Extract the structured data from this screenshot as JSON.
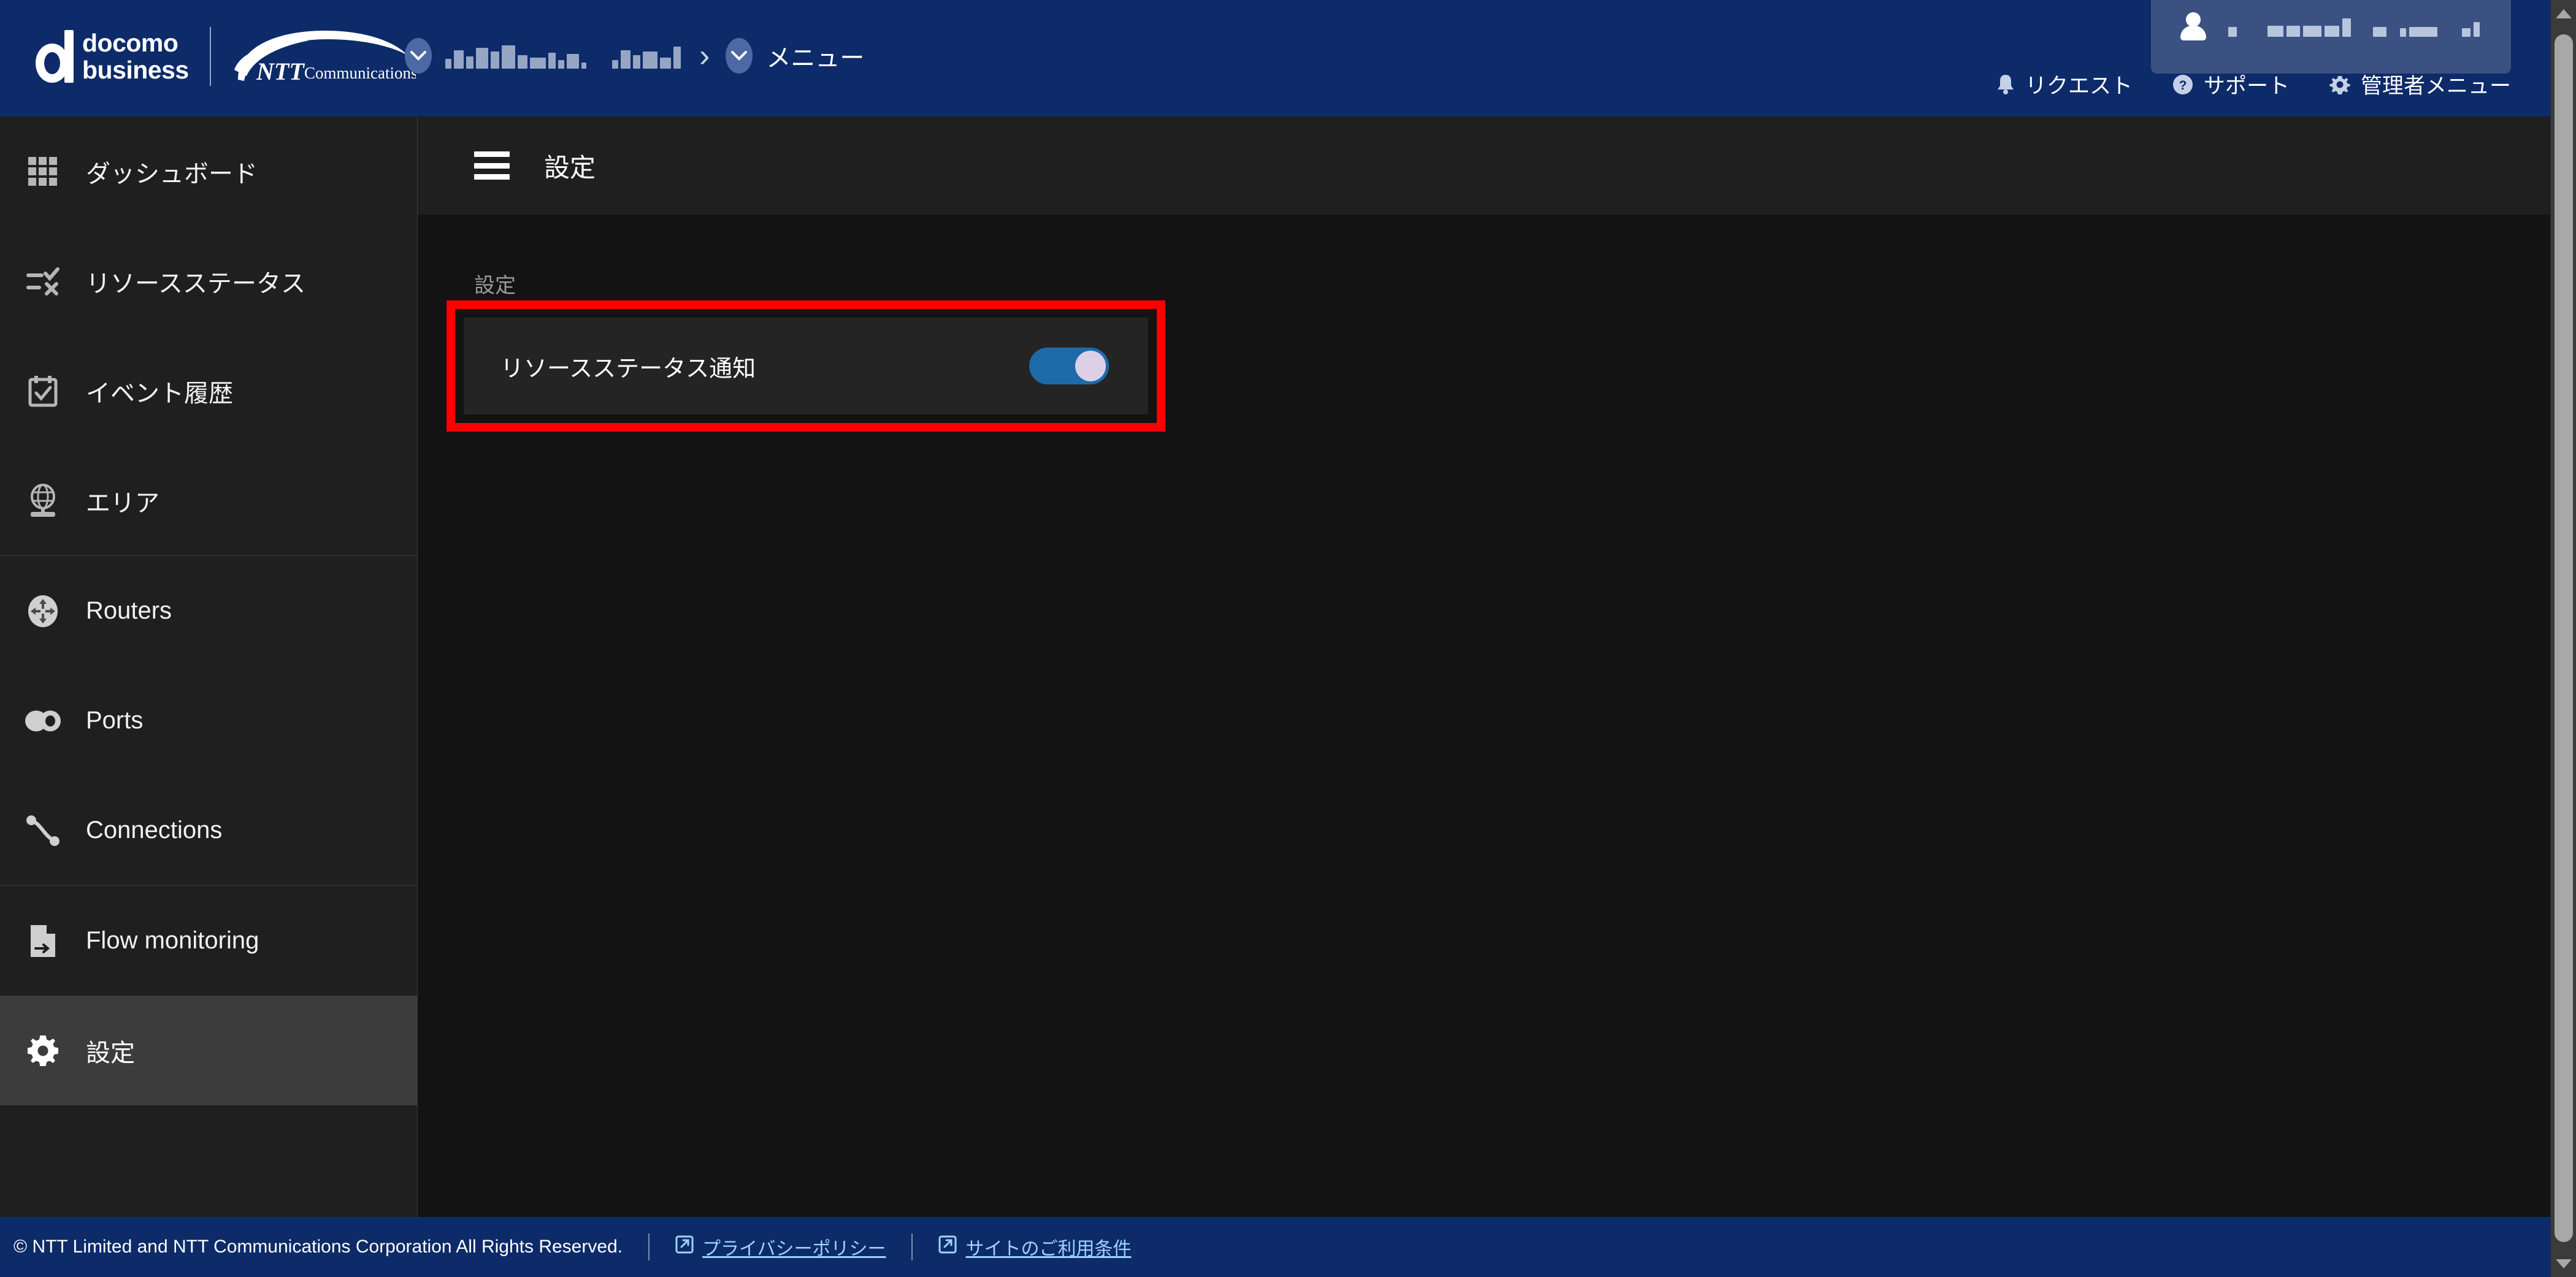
{
  "header": {
    "brand_primary": "docomo business",
    "brand_primary_line1": "docomo",
    "brand_primary_line2": "business",
    "brand_secondary": "NTT Communications",
    "brand_secondary_mark": "NTT",
    "breadcrumb": {
      "company_icon": "chevron-down-circle-icon",
      "company_name": "",
      "separator": "›",
      "menu_icon": "chevron-down-circle-icon",
      "menu_label": "メニュー"
    },
    "user": {
      "icon": "user-icon",
      "name": ""
    },
    "links": [
      {
        "icon": "bell-icon",
        "label": "リクエスト"
      },
      {
        "icon": "question-circle-icon",
        "label": "サポート"
      },
      {
        "icon": "gear-icon",
        "label": "管理者メニュー"
      }
    ],
    "colors": {
      "background": "#0d2b69",
      "user_pill": "#3a5182"
    }
  },
  "sidebar": {
    "groups": [
      {
        "items": [
          {
            "icon": "grid-icon",
            "label": "ダッシュボード",
            "active": false
          },
          {
            "icon": "list-check-icon",
            "label": "リソースステータス",
            "active": false
          },
          {
            "icon": "calendar-check-icon",
            "label": "イベント履歴",
            "active": false
          },
          {
            "icon": "globe-pin-icon",
            "label": "エリア",
            "active": false
          }
        ]
      },
      {
        "items": [
          {
            "icon": "router-icon",
            "label": "Routers",
            "active": false
          },
          {
            "icon": "ports-icon",
            "label": "Ports",
            "active": false
          },
          {
            "icon": "connections-icon",
            "label": "Connections",
            "active": false
          }
        ]
      },
      {
        "items": [
          {
            "icon": "file-arrow-icon",
            "label": "Flow monitoring",
            "active": false
          },
          {
            "icon": "gear-icon",
            "label": "設定",
            "active": true
          }
        ]
      }
    ]
  },
  "main": {
    "menu_icon": "hamburger-icon",
    "page_title": "設定",
    "section_label": "設定",
    "settings": [
      {
        "label": "リソースステータス通知",
        "control": "toggle-switch",
        "value": "on",
        "highlighted": true,
        "highlight_color": "#ff0000"
      }
    ]
  },
  "footer": {
    "copyright": "© NTT Limited and NTT Communications Corporation All Rights Reserved.",
    "links": [
      {
        "icon": "external-link-icon",
        "label": "プライバシーポリシー"
      },
      {
        "icon": "external-link-icon",
        "label": "サイトのご利用条件"
      }
    ]
  },
  "scrollbar": {
    "up_arrow": "triangle-up-icon",
    "down_arrow": "triangle-down-icon"
  }
}
